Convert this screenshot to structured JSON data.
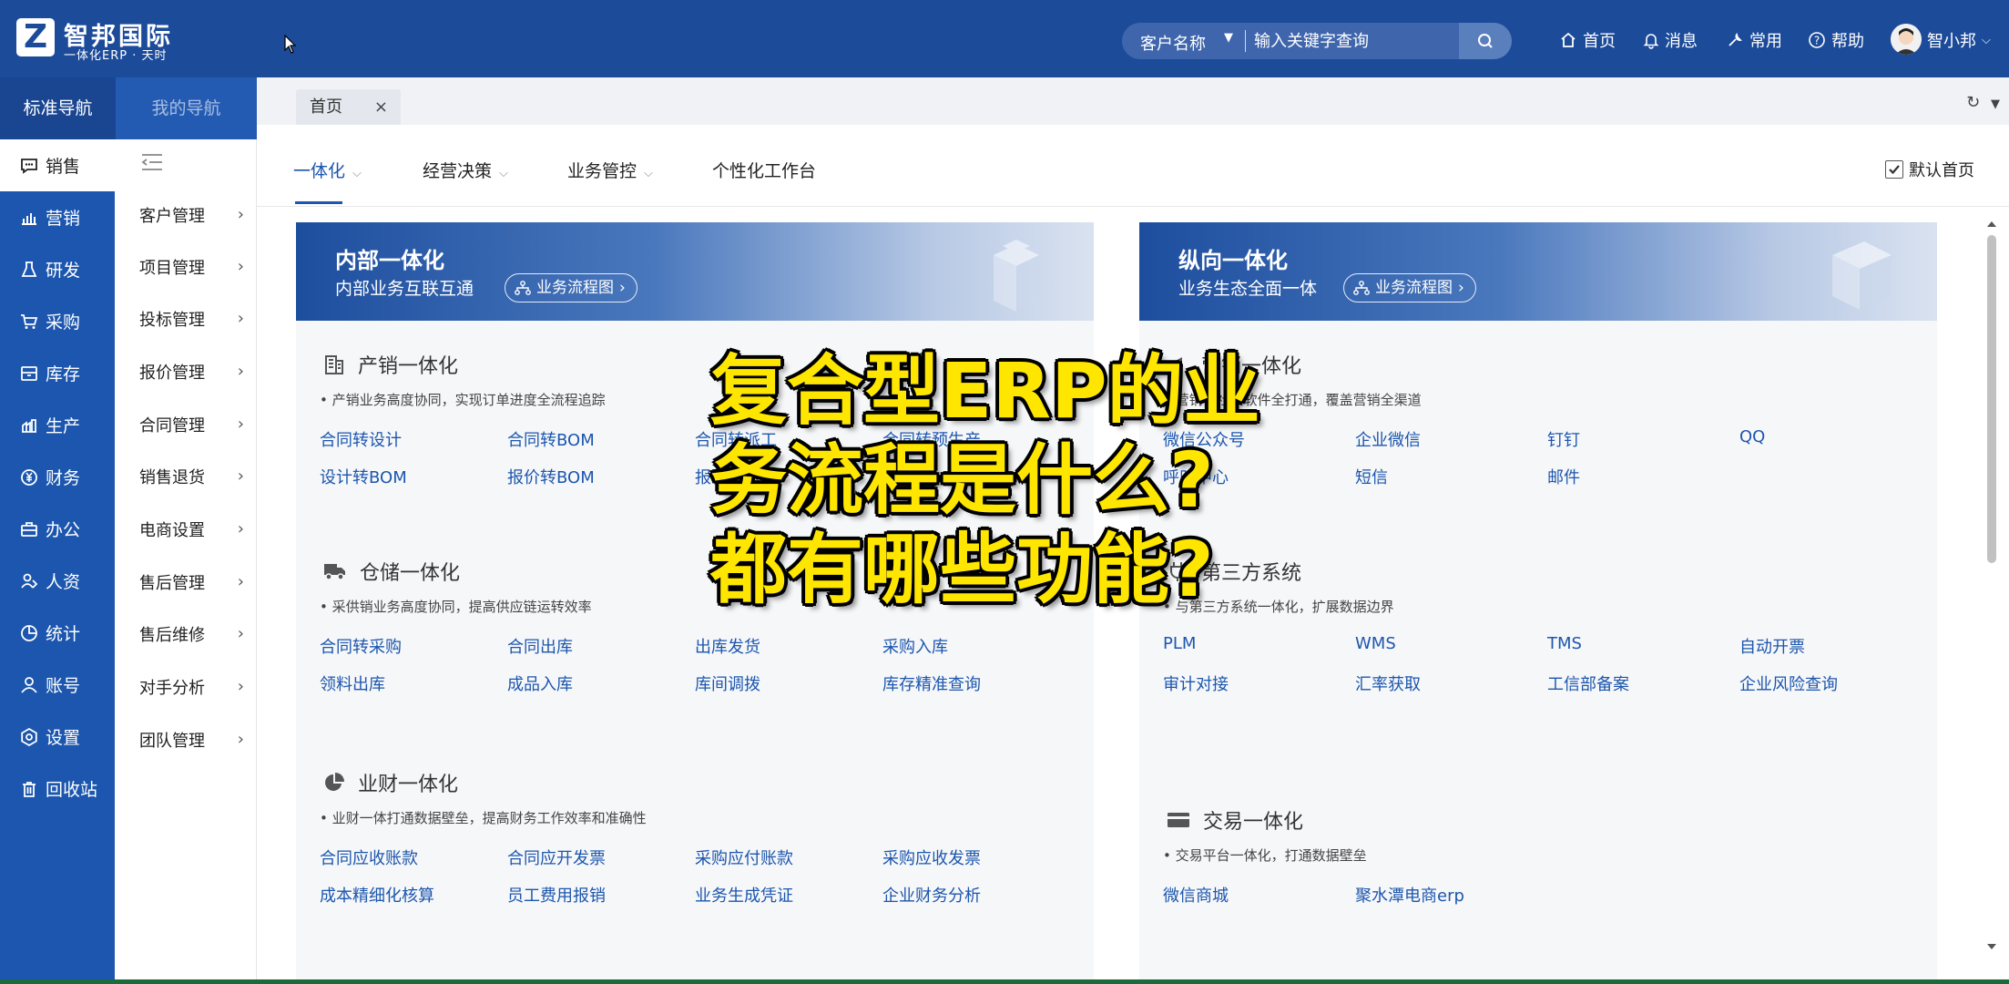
{
  "brand": {
    "title": "智邦国际",
    "subtitle": "一体化ERP · 天时",
    "logo_letter": "Z"
  },
  "search": {
    "category": "客户名称",
    "placeholder": "输入关键字查询"
  },
  "topnav": {
    "home": "首页",
    "messages": "消息",
    "common": "常用",
    "help": "帮助",
    "user": "智小邦"
  },
  "nav_tabs": [
    "标准导航",
    "我的导航"
  ],
  "sidebar": {
    "items": [
      {
        "label": "销售",
        "icon": "chat-icon"
      },
      {
        "label": "营销",
        "icon": "bar-chart-icon"
      },
      {
        "label": "研发",
        "icon": "flask-icon"
      },
      {
        "label": "采购",
        "icon": "cart-icon"
      },
      {
        "label": "库存",
        "icon": "inventory-icon"
      },
      {
        "label": "生产",
        "icon": "production-icon"
      },
      {
        "label": "财务",
        "icon": "yuan-icon"
      },
      {
        "label": "办公",
        "icon": "briefcase-icon"
      },
      {
        "label": "人资",
        "icon": "people-icon"
      },
      {
        "label": "统计",
        "icon": "pie-icon"
      },
      {
        "label": "账号",
        "icon": "user-icon"
      },
      {
        "label": "设置",
        "icon": "gear-icon"
      },
      {
        "label": "回收站",
        "icon": "trash-icon"
      }
    ]
  },
  "submenu": {
    "items": [
      "客户管理",
      "项目管理",
      "投标管理",
      "报价管理",
      "合同管理",
      "销售退货",
      "电商设置",
      "售后管理",
      "售后维修",
      "对手分析",
      "团队管理"
    ]
  },
  "tabstrip": {
    "home_tab": "首页"
  },
  "content_tabs": [
    "一体化",
    "经营决策",
    "业务管控",
    "个性化工作台"
  ],
  "default_home": "默认首页",
  "flow_label": "业务流程图",
  "left_panel": {
    "title": "内部一体化",
    "subtitle": "内部业务互联互通",
    "groups": [
      {
        "title": "产销一体化",
        "desc": "• 产销业务高度协同，实现订单进度全流程追踪",
        "links": [
          "合同转设计",
          "合同转BOM",
          "合同转派工",
          "合同转预生产",
          "设计转BOM",
          "报价转BOM",
          "报价转派工"
        ]
      },
      {
        "title": "仓储一体化",
        "desc": "• 采供销业务高度协同，提高供应链运转效率",
        "links": [
          "合同转采购",
          "合同出库",
          "出库发货",
          "采购入库",
          "领料出库",
          "成品入库",
          "库间调拨",
          "库存精准查询"
        ]
      },
      {
        "title": "业财一体化",
        "desc": "• 业财一体打通数据壁垒，提高财务工作效率和准确性",
        "links": [
          "合同应收账款",
          "合同应开发票",
          "采购应付账款",
          "采购应收发票",
          "成本精细化核算",
          "员工费用报销",
          "业务生成凭证",
          "企业财务分析"
        ]
      }
    ]
  },
  "right_panel": {
    "title": "纵向一体化",
    "subtitle": "业务生态全面一体",
    "groups": [
      {
        "title": "营销一体化",
        "desc": "• 营销与社交软件全打通，覆盖营销全渠道",
        "links": [
          "微信公众号",
          "企业微信",
          "钉钉",
          "QQ",
          "呼叫中心",
          "短信",
          "邮件"
        ]
      },
      {
        "title": "第三方系统",
        "desc": "• 与第三方系统一体化，扩展数据边界",
        "links": [
          "PLM",
          "WMS",
          "TMS",
          "自动开票",
          "审计对接",
          "汇率获取",
          "工信部备案",
          "企业风险查询"
        ]
      },
      {
        "title": "交易一体化",
        "desc": "• 交易平台一体化，打通数据壁垒",
        "links": [
          "微信商城",
          "聚水潭电商erp"
        ]
      }
    ]
  },
  "overlay": {
    "lines": [
      "复合型ERP的业",
      "务流程是什么?",
      "都有哪些功能?"
    ]
  }
}
